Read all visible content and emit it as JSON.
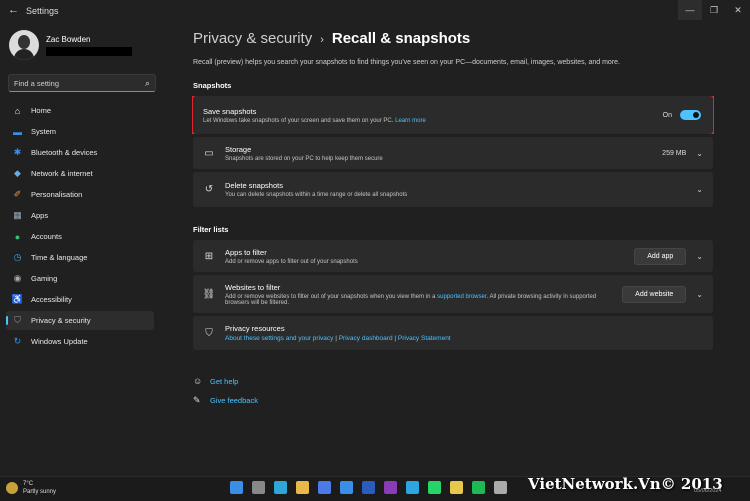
{
  "window": {
    "title": "Settings"
  },
  "profile": {
    "name": "Zac Bowden"
  },
  "search": {
    "placeholder": "Find a setting"
  },
  "nav": [
    {
      "label": "Home",
      "icon": "home-icon",
      "color": "#f0f0f0"
    },
    {
      "label": "System",
      "icon": "system-icon",
      "color": "#3b8ee8"
    },
    {
      "label": "Bluetooth & devices",
      "icon": "bluetooth-icon",
      "color": "#3b8ee8"
    },
    {
      "label": "Network & internet",
      "icon": "network-icon",
      "color": "#5fb0f0"
    },
    {
      "label": "Personalisation",
      "icon": "brush-icon",
      "color": "#e49a4a"
    },
    {
      "label": "Apps",
      "icon": "apps-icon",
      "color": "#9ab"
    },
    {
      "label": "Accounts",
      "icon": "accounts-icon",
      "color": "#3dbb7a"
    },
    {
      "label": "Time & language",
      "icon": "time-icon",
      "color": "#4aa6e8"
    },
    {
      "label": "Gaming",
      "icon": "gaming-icon",
      "color": "#aaa"
    },
    {
      "label": "Accessibility",
      "icon": "accessibility-icon",
      "color": "#4aa6e8"
    },
    {
      "label": "Privacy & security",
      "icon": "shield-icon",
      "color": "#999",
      "selected": true
    },
    {
      "label": "Windows Update",
      "icon": "update-icon",
      "color": "#3b8ee8"
    }
  ],
  "breadcrumb": {
    "parent": "Privacy & security",
    "current": "Recall & snapshots"
  },
  "description": "Recall (preview) helps you search your snapshots to find things you've seen on your PC—documents, email, images, websites, and more.",
  "snapshots": {
    "heading": "Snapshots",
    "save": {
      "title": "Save snapshots",
      "subtitle": "Let Windows take snapshots of your screen and save them on your PC.",
      "link": "Learn more",
      "state": "On"
    },
    "storage": {
      "title": "Storage",
      "subtitle": "Snapshots are stored on your PC to help keep them secure",
      "value": "259 MB"
    },
    "delete": {
      "title": "Delete snapshots",
      "subtitle": "You can delete snapshots within a time range or delete all snapshots"
    }
  },
  "filters": {
    "heading": "Filter lists",
    "apps": {
      "title": "Apps to filter",
      "subtitle": "Add or remove apps to filter out of your snapshots",
      "button": "Add app"
    },
    "websites": {
      "title": "Websites to filter",
      "subtitle_a": "Add or remove websites to filter out of your snapshots when you view them in a",
      "subtitle_link": "supported browser",
      "subtitle_b": ". All private browsing activity in supported browsers will be filtered.",
      "button": "Add website"
    },
    "resources": {
      "title": "Privacy resources",
      "link1": "About these settings and your privacy",
      "sep1": " | ",
      "link2": "Privacy dashboard",
      "sep2": " | ",
      "link3": "Privacy Statement"
    }
  },
  "help": {
    "get_help": "Get help",
    "feedback": "Give feedback"
  },
  "taskbar": {
    "weather_temp": "7°C",
    "weather_desc": "Partly sunny",
    "icons": [
      "start-icon",
      "search-icon",
      "edge-icon",
      "explorer-icon",
      "store-icon",
      "photos-icon",
      "word-icon",
      "onenote-icon",
      "telegram-icon",
      "whatsapp-icon",
      "star-app-icon",
      "spotify-icon",
      "settings-icon"
    ],
    "icon_colors": [
      "#3b8ee8",
      "#888",
      "#2ea6d8",
      "#e8b84a",
      "#4a7be8",
      "#3b8ee8",
      "#2b5bbd",
      "#8a3bb8",
      "#2ca5e0",
      "#25d366",
      "#e8c84a",
      "#1db954",
      "#aaa"
    ],
    "date": "05/06/2024"
  },
  "watermark": "VietNetwork.Vn© 2013"
}
